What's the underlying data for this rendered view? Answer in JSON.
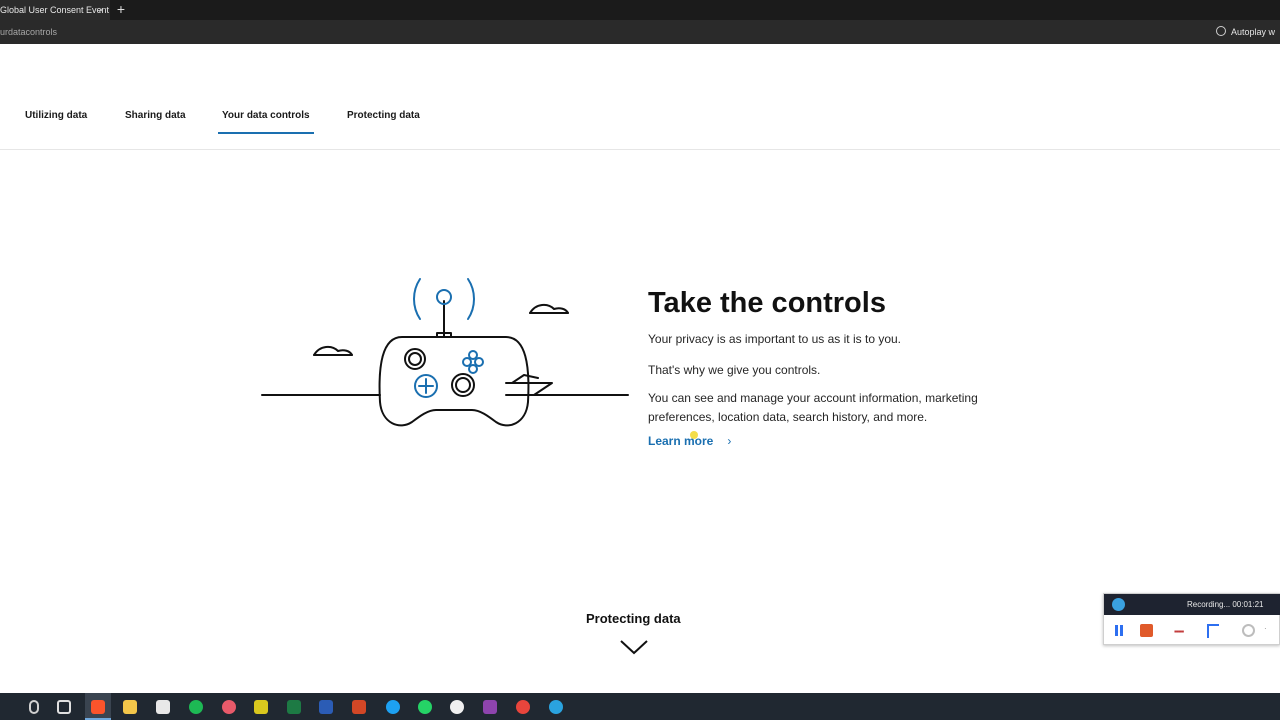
{
  "browser": {
    "tab_title": "Global User Consent Event",
    "tab_close": "×",
    "new_tab": "+",
    "url": "urdatacontrols",
    "autoplay_label": "Autoplay w"
  },
  "subnav": {
    "items": [
      {
        "label": "Utilizing data"
      },
      {
        "label": "Sharing data"
      },
      {
        "label": "Your data controls"
      },
      {
        "label": "Protecting data"
      }
    ],
    "active_index": 2
  },
  "hero": {
    "headline": "Take the controls",
    "paragraph_1": "Your privacy is as important to us as it is to you.",
    "paragraph_2": "That's why we give you controls.",
    "paragraph_3": "You can see and manage your account information, marketing preferences, location data, search history, and more.",
    "learn_more": "Learn more",
    "chevron": "›"
  },
  "next_section": {
    "label": "Protecting data"
  },
  "recorder": {
    "status": "Recording... 00:01:21"
  },
  "colors": {
    "accent": "#1a6fb0",
    "taskbar": "#202831",
    "browser_chrome": "#1b1b1b",
    "stop_button": "#e05a2a"
  },
  "taskbar": {
    "icons": [
      "microphone-icon",
      "task-view-icon",
      "brave-browser-icon",
      "file-explorer-icon",
      "mail-icon",
      "spotify-icon",
      "app-icon",
      "fireworks-icon",
      "excel-icon",
      "word-icon",
      "powerpoint-icon",
      "skype-icon",
      "whatsapp-icon",
      "photos-icon",
      "app-icon",
      "chrome-icon",
      "telegram-icon"
    ]
  }
}
